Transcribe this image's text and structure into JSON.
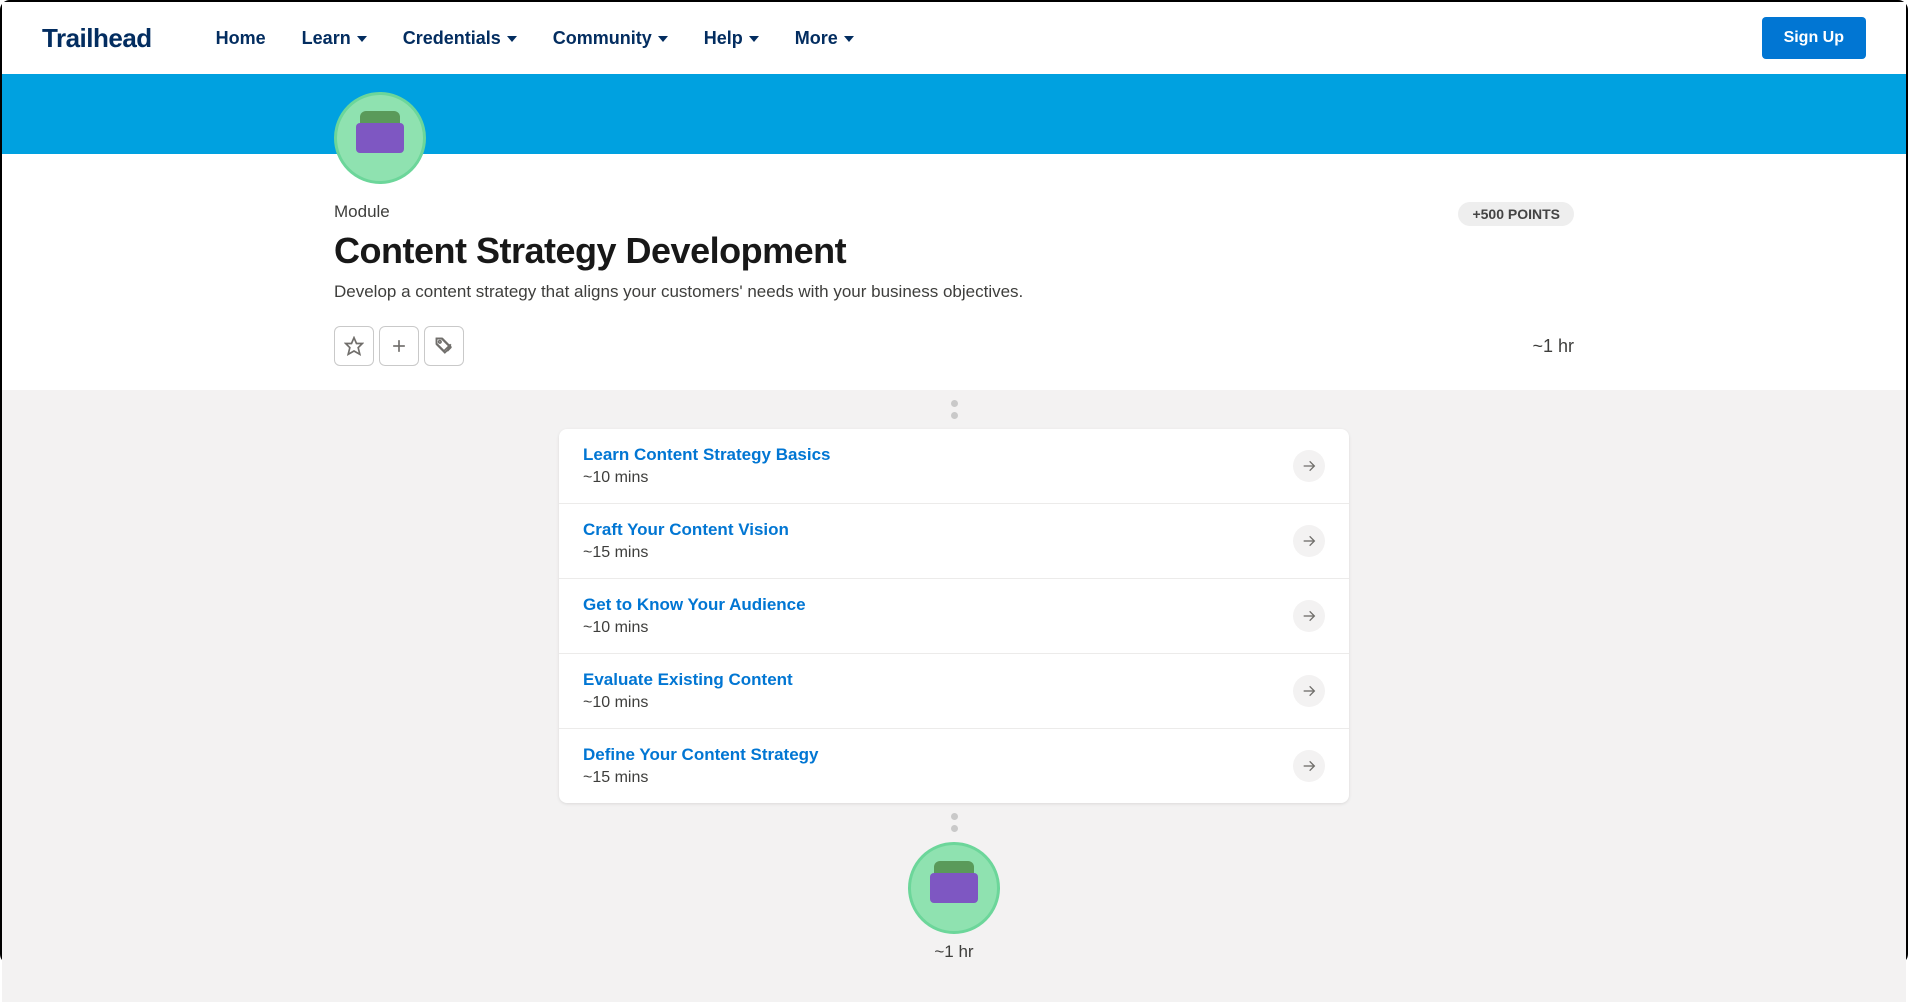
{
  "logo": "Trailhead",
  "nav": {
    "home": "Home",
    "learn": "Learn",
    "credentials": "Credentials",
    "community": "Community",
    "help": "Help",
    "more": "More"
  },
  "signup": "Sign Up",
  "module_label": "Module",
  "title": "Content Strategy Development",
  "description": "Develop a content strategy that aligns your customers' needs with your business objectives.",
  "points": "+500 POINTS",
  "duration": "~1 hr",
  "units": [
    {
      "title": "Learn Content Strategy Basics",
      "time": "~10 mins"
    },
    {
      "title": "Craft Your Content Vision",
      "time": "~15 mins"
    },
    {
      "title": "Get to Know Your Audience",
      "time": "~10 mins"
    },
    {
      "title": "Evaluate Existing Content",
      "time": "~10 mins"
    },
    {
      "title": "Define Your Content Strategy",
      "time": "~15 mins"
    }
  ],
  "bottom_duration": "~1 hr"
}
